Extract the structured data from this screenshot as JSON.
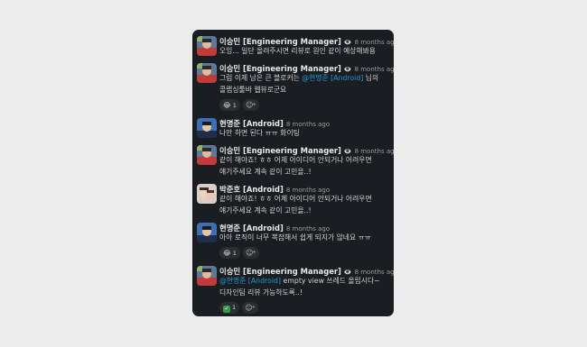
{
  "users": {
    "lee": {
      "name": "이승민 [Engineering Manager]",
      "status_emoji": "👁️"
    },
    "hyun": {
      "name": "현명준 [Android]"
    },
    "park": {
      "name": "박준호 [Android]"
    }
  },
  "messages": [
    {
      "author": "이승민 [Engineering Manager]",
      "time": "8 months ago",
      "text": "오잉... 일단 올려주시면 리뷰로 원인 같이 예상해봐용"
    },
    {
      "author": "이승민 [Engineering Manager]",
      "time": "8 months ago",
      "text_before": "그럼 이제 남은 큰 블로커는 ",
      "mention": "@현명준 [Android]",
      "text_after": " 님의 콜랩싱툴바 웹뷰로군요",
      "reaction_emoji": "😂",
      "reaction_count": "1"
    },
    {
      "author": "현명준 [Android]",
      "time": "8 months ago",
      "text": "나만 하면 된다 ㅠㅠ 화이팅"
    },
    {
      "author": "이승민 [Engineering Manager]",
      "time": "8 months ago",
      "text": "같이 해야죠! ㅎㅎ 어제 아이디어 안되거나 어려우면 얘기주세요 계속 같이 고민을..!"
    },
    {
      "author": "박준호 [Android]",
      "time": "8 months ago",
      "text": "같이 해야죠! ㅎㅎ 어제 아이디어 안되거나 어려우면 얘기주세요 계속 같이 고민을..!"
    },
    {
      "author": "현명준 [Android]",
      "time": "8 months ago",
      "text": "아아 로직이 너무 복잡해서 쉽게 되지가 않네요 ㅠㅠ",
      "reaction_emoji": "😂",
      "reaction_count": "1"
    },
    {
      "author": "이승민 [Engineering Manager]",
      "time": "8 months ago",
      "mention": "@현명준 [Android]",
      "text_after": " empty view 쓰레드 올립시다~ 디자인팀 리뷰 가능하도록..!",
      "reaction_emoji": "✅",
      "reaction_count": "1"
    }
  ],
  "icons": {
    "add_reaction": "add-reaction-icon"
  },
  "colors": {
    "panel_bg": "#1a1d21",
    "mention": "#1d9bd1",
    "reaction_bg": "#2b2d31"
  }
}
